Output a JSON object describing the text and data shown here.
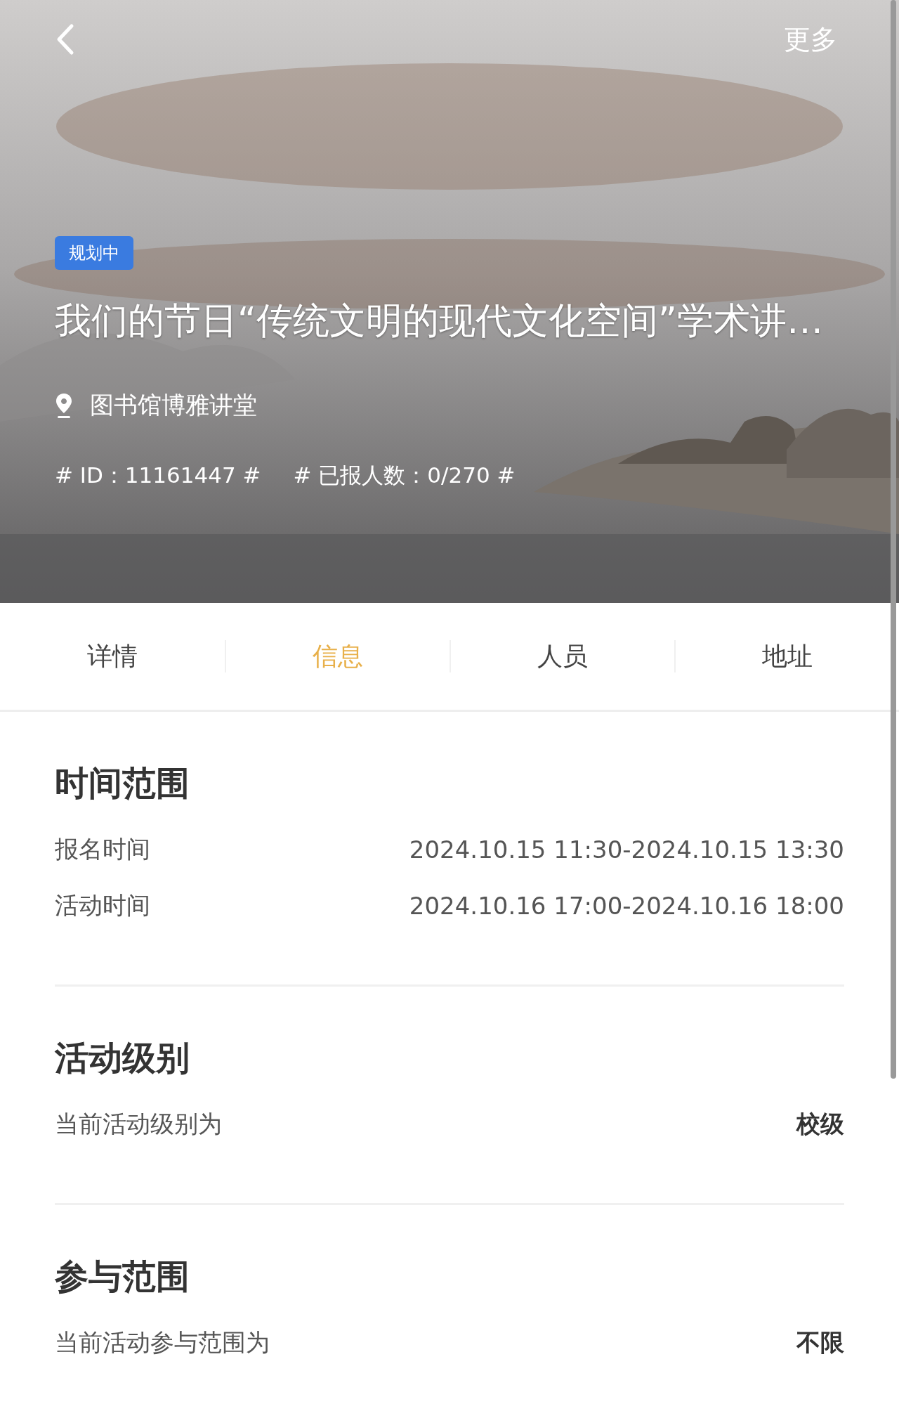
{
  "header": {
    "kind": "picture",
    "more": "更多",
    "badge": "规划中",
    "title": "我们的节日“传统文明的现代文化空间”学术讲…",
    "location": "图书馆博雅讲堂",
    "id_tag": "# ID：11161447 #",
    "count_tag": "# 已报人数：0/270 #"
  },
  "tabs": [
    {
      "label": "详情",
      "selected": false
    },
    {
      "label": "信息",
      "selected": true
    },
    {
      "label": "人员",
      "selected": false
    },
    {
      "label": "地址",
      "selected": false
    }
  ],
  "sections": [
    {
      "title": "时间范围",
      "rows": [
        {
          "kind": "time",
          "label": "报名时间",
          "value": "2024.10.15 11:30-2024.10.15 13:30"
        },
        {
          "kind": "time",
          "label": "活动时间",
          "value": "2024.10.16 17:00-2024.10.16 18:00"
        }
      ]
    },
    {
      "title": "活动级别",
      "rows": [
        {
          "kind": "summary",
          "label": "当前活动级别为",
          "value": "校级"
        }
      ]
    },
    {
      "title": "参与范围",
      "rows": [
        {
          "kind": "summary",
          "label": "当前活动参与范围为",
          "value": "不限"
        }
      ]
    }
  ]
}
